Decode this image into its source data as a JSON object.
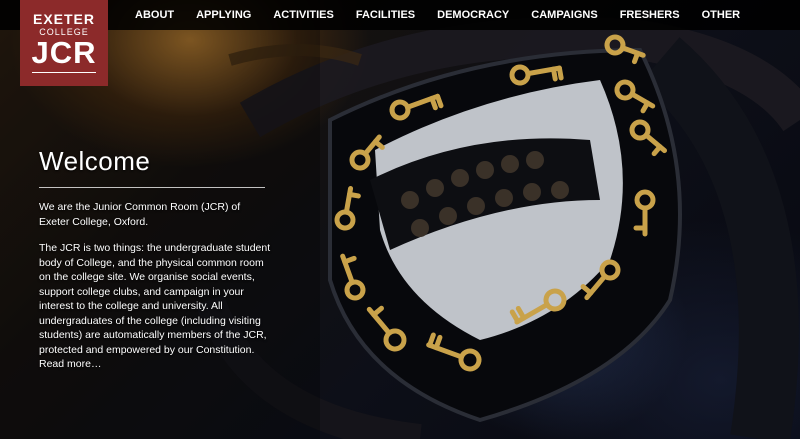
{
  "logo": {
    "line1": "EXETER",
    "line2": "COLLEGE",
    "line3": "JCR"
  },
  "nav": {
    "items": [
      {
        "label": "ABOUT"
      },
      {
        "label": "APPLYING"
      },
      {
        "label": "ACTIVITIES"
      },
      {
        "label": "FACILITIES"
      },
      {
        "label": "DEMOCRACY"
      },
      {
        "label": "CAMPAIGNS"
      },
      {
        "label": "FRESHERS"
      },
      {
        "label": "OTHER"
      }
    ]
  },
  "hero": {
    "title": "Welcome",
    "intro": "We are the Junior Common Room (JCR) of Exeter College, Oxford.",
    "body": "The JCR is two things: the undergraduate student body of College, and the physical common room on the college site. We organise social events, support college clubs, and campaign in your interest to the college and university. All undergraduates of the college (including visiting students) are automatically members of the JCR, protected and empowered by our Constitution.",
    "read_more": "Read more…"
  },
  "colors": {
    "brand": "#8c2a2a",
    "nav_bg": "#000000",
    "text": "#ffffff",
    "crest_gold": "#c9a24a",
    "crest_silver": "#c9cdd3"
  },
  "icons": {
    "crest": "shield-crest-icon"
  }
}
